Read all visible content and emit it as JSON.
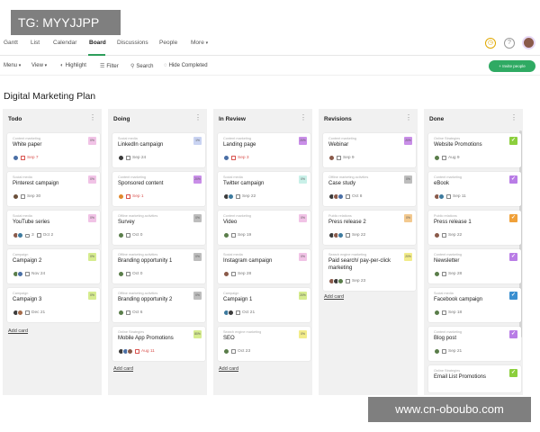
{
  "watermark_top": "TG: MYYJJPP",
  "watermark_bottom": "www.cn-oboubo.com",
  "nav": {
    "tabs": [
      "Gantt",
      "List",
      "Calendar",
      "Board",
      "Discussions",
      "People",
      "More"
    ]
  },
  "toolbar": {
    "menu": "Menu",
    "view": "View",
    "highlight": "Highlight",
    "filter": "Filter",
    "search": "Search",
    "hide_completed": "Hide Completed",
    "invite": "Invite people"
  },
  "board": {
    "title": "Digital Marketing Plan",
    "add_card": "Add card",
    "columns": [
      {
        "name": "Todo",
        "cards": [
          {
            "category": "Content marketing",
            "title": "White paper",
            "date": "Sep 7",
            "tag": "0%"
          },
          {
            "category": "Social media",
            "title": "Pinterest campaign",
            "date": "Sep 30",
            "tag": "0%"
          },
          {
            "category": "Social media",
            "title": "YouTube series",
            "comments": "3",
            "date": "Oct 2",
            "tag": "0%"
          },
          {
            "category": "Campaign",
            "title": "Campaign 2",
            "date": "Nov 24",
            "tag": "0%"
          },
          {
            "category": "Campaign",
            "title": "Campaign 3",
            "date": "Dec 21",
            "tag": "0%"
          }
        ]
      },
      {
        "name": "Doing",
        "cards": [
          {
            "category": "Social media",
            "title": "LinkedIn campaign",
            "date": "Sep 24",
            "tag": "1%"
          },
          {
            "category": "Content marketing",
            "title": "Sponsored content",
            "date": "Sep 1",
            "tag": "20%"
          },
          {
            "category": "Offline marketing activities",
            "title": "Survey",
            "date": "Oct 0",
            "tag": "0%"
          },
          {
            "category": "Offline marketing activities",
            "title": "Branding opportunity 1",
            "date": "Oct 0",
            "tag": "0%"
          },
          {
            "category": "Offline marketing activities",
            "title": "Branding opportunity 2",
            "date": "Oct 6",
            "tag": "0%"
          },
          {
            "category": "Online Strategies",
            "title": "Mobile App Promotions",
            "date": "Aug 11",
            "tag": "80%"
          }
        ]
      },
      {
        "name": "In Review",
        "cards": [
          {
            "category": "Content marketing",
            "title": "Landing page",
            "date": "Sep 3",
            "tag": "20%"
          },
          {
            "category": "Social media",
            "title": "Twitter campaign",
            "date": "Sep 22",
            "tag": "0%"
          },
          {
            "category": "Content marketing",
            "title": "Video",
            "date": "Sep 19",
            "tag": "0%"
          },
          {
            "category": "Social media",
            "title": "Instagram campaign",
            "date": "Sep 28",
            "tag": "0%"
          },
          {
            "category": "Campaign",
            "title": "Campaign 1",
            "date": "Oct 21",
            "tag": "20%"
          },
          {
            "category": "Search engine marketing",
            "title": "SEO",
            "date": "Oct 23",
            "tag": "0%"
          }
        ]
      },
      {
        "name": "Revisions",
        "cards": [
          {
            "category": "Content marketing",
            "title": "Webinar",
            "date": "Sep 9",
            "tag": "20%"
          },
          {
            "category": "Offline marketing activities",
            "title": "Case study",
            "date": "Oct 8",
            "tag": "0%"
          },
          {
            "category": "Public relations",
            "title": "Press release 2",
            "date": "Sep 22",
            "tag": "0%"
          },
          {
            "category": "Search engine marketing",
            "title": "Paid search/ pay-per-click marketing",
            "date": "Sep 23",
            "tag": "20%"
          }
        ]
      },
      {
        "name": "Done",
        "cards": [
          {
            "category": "Online Strategies",
            "title": "Website Promotions",
            "date": "Aug 9"
          },
          {
            "category": "Content marketing",
            "title": "eBook",
            "date": "Sep 11"
          },
          {
            "category": "Public relations",
            "title": "Press release 1",
            "date": "Sep 22"
          },
          {
            "category": "Content marketing",
            "title": "Newsletter",
            "date": "Sep 28"
          },
          {
            "category": "Social media",
            "title": "Facebook campaign",
            "date": "Sep 18"
          },
          {
            "category": "Content marketing",
            "title": "Blog post",
            "date": "Sep 21"
          },
          {
            "category": "Online Strategies",
            "title": "Email List Promotions"
          }
        ]
      }
    ]
  },
  "colors": {
    "accent_green": "#2faa63",
    "tag_pink": "#f1c3e6",
    "tag_purple": "#c98ee8",
    "tag_blue": "#c9d3f2",
    "tag_gray": "#bdbdbd",
    "tag_orange": "#f3c98f",
    "tag_green": "#d6ec8f",
    "tag_yellow": "#f2ec8a",
    "check_green": "#8ccf3d",
    "check_purple": "#b97de6",
    "check_orange": "#f0a13a",
    "check_blue": "#3a8fd0",
    "date_red": "#d9534f"
  }
}
